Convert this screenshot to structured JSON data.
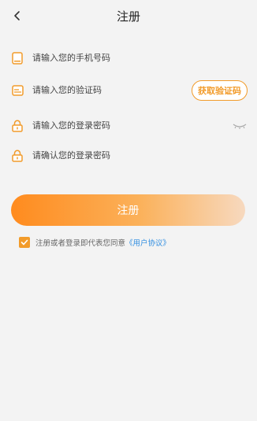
{
  "header": {
    "title": "注册"
  },
  "form": {
    "phone_placeholder": "请输入您的手机号码",
    "code_placeholder": "请输入您的验证码",
    "get_code_label": "获取验证码",
    "password_placeholder": "请输入您的登录密码",
    "confirm_placeholder": "请确认您的登录密码"
  },
  "register_label": "注册",
  "agreement": {
    "checked": true,
    "text": "注册或者登录即代表您同意",
    "link_label": "《用户协议》"
  },
  "colors": {
    "accent": "#f29b2a",
    "link": "#2f8de0",
    "background": "#f3f3f3"
  },
  "icons": {
    "back": "chevron-left-icon",
    "phone": "phone-icon",
    "code": "message-icon",
    "password": "lock-icon",
    "confirm": "lock-icon",
    "eye": "eye-hidden-icon",
    "checkbox": "check-icon"
  }
}
